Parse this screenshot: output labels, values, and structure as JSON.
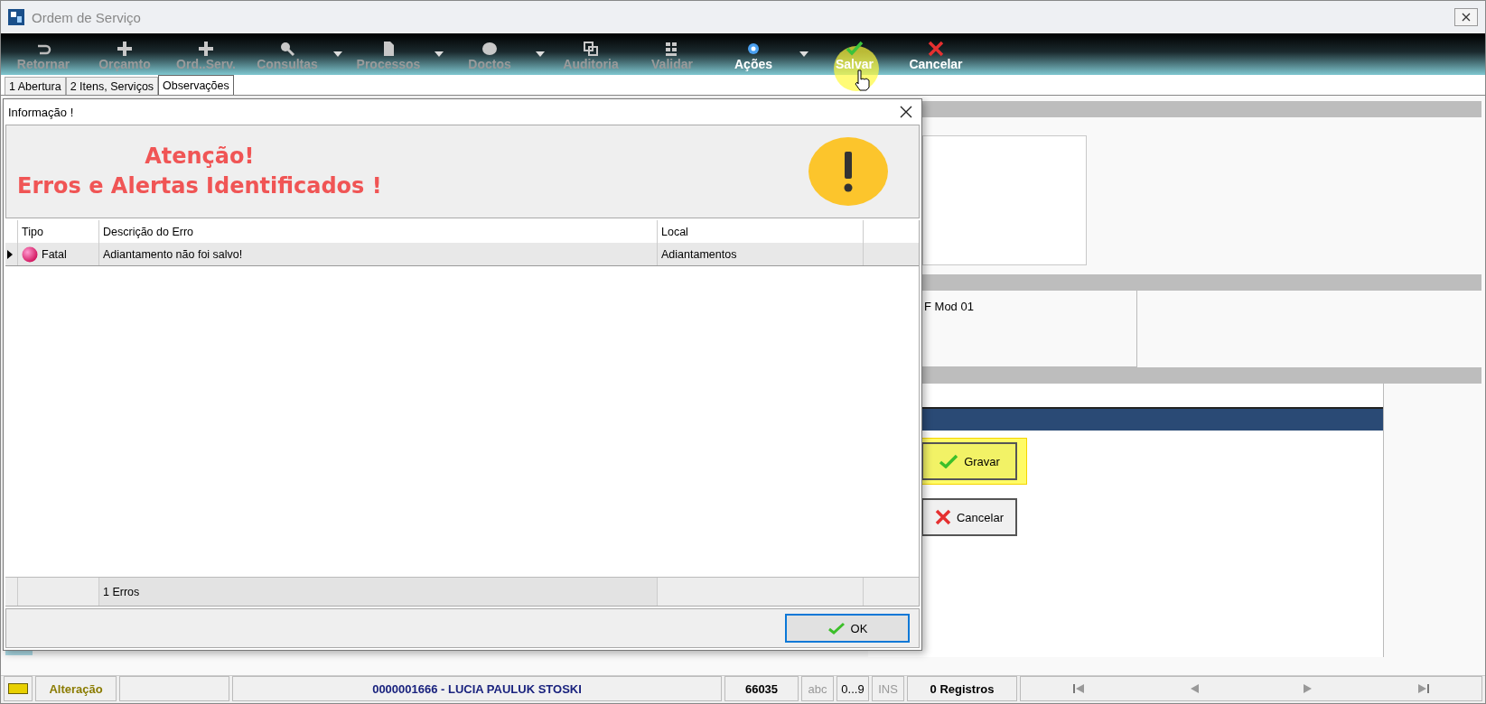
{
  "window": {
    "title": "Ordem de Serviço"
  },
  "toolbar": [
    {
      "label": "Retornar",
      "disabled": true,
      "dropdown": false
    },
    {
      "label": "Orçamto",
      "disabled": true,
      "dropdown": false
    },
    {
      "label": "Ord..Serv.",
      "disabled": true,
      "dropdown": false
    },
    {
      "label": "Consultas",
      "disabled": true,
      "dropdown": true
    },
    {
      "label": "Processos",
      "disabled": true,
      "dropdown": true
    },
    {
      "label": "Doctos",
      "disabled": true,
      "dropdown": true
    },
    {
      "label": "Auditoria",
      "disabled": true,
      "dropdown": false
    },
    {
      "label": "Validar",
      "disabled": true,
      "dropdown": false
    },
    {
      "label": "Ações",
      "disabled": false,
      "dropdown": true
    },
    {
      "label": "Salvar",
      "disabled": false,
      "dropdown": false
    },
    {
      "label": "Cancelar",
      "disabled": false,
      "dropdown": false
    }
  ],
  "tabs": [
    {
      "label": "1 Abertura",
      "selected": false
    },
    {
      "label": "2 Itens, Serviços",
      "selected": false
    },
    {
      "label": "Observações",
      "selected": true
    }
  ],
  "form": {
    "field_text": "F Mod 01",
    "buttons": [
      {
        "label": "Gravar",
        "kind": "save",
        "highlighted": true
      },
      {
        "label": "Cancelar",
        "kind": "cancel",
        "highlighted": false
      }
    ]
  },
  "dialog": {
    "title": "Informação !",
    "heading": [
      "Atenção!",
      "Erros e Alertas Identificados !"
    ],
    "table": {
      "columns": [
        "Tipo",
        "Descrição do Erro",
        "Local"
      ],
      "rows": [
        {
          "type": "Fatal",
          "description": "Adiantamento não foi salvo!",
          "local": "Adiantamentos",
          "selected": true
        }
      ]
    },
    "footer": "1 Erros",
    "ok_button": "OK"
  },
  "status_bar": {
    "mode": "Alteração",
    "record": "0000001666 - LUCIA PAULUK STOSKI",
    "code": "66035",
    "indicators": [
      {
        "label": "abc",
        "on": false
      },
      {
        "label": "0...9",
        "on": true
      },
      {
        "label": "INS",
        "on": false
      }
    ],
    "count": "0 Registros"
  }
}
